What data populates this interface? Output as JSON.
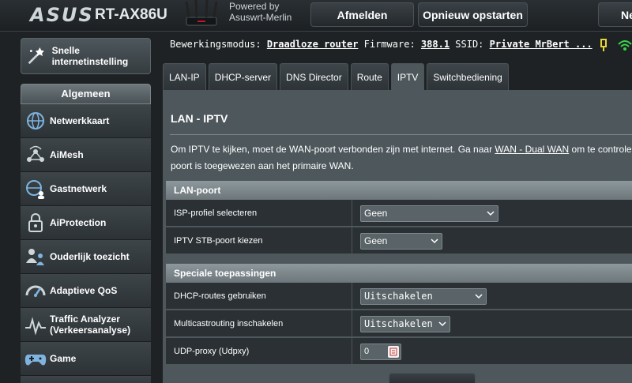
{
  "header": {
    "brand": "ASUS",
    "model": "RT-AX86U",
    "powered_by_line1": "Powered by",
    "powered_by_line2": "Asuswrt-Merlin",
    "logout_label": "Afmelden",
    "reboot_label": "Opnieuw opstarten",
    "partial_button_label": "Ne"
  },
  "status": {
    "mode_label": "Bewerkingsmodus:",
    "mode_value": "Draadloze router",
    "firmware_label": "Firmware:",
    "firmware_value": "388.1",
    "ssid_label": "SSID:",
    "ssid_value": "Private MrBert ..."
  },
  "sidebar": {
    "quick_setup": "Snelle internetinstelling",
    "section_title": "Algemeen",
    "items": [
      {
        "label": "Netwerkkaart",
        "icon": "network-map-icon"
      },
      {
        "label": "AiMesh",
        "icon": "aimesh-icon"
      },
      {
        "label": "Gastnetwerk",
        "icon": "guest-network-icon"
      },
      {
        "label": "AiProtection",
        "icon": "aiprotection-lock-icon"
      },
      {
        "label": "Ouderlijk toezicht",
        "icon": "parental-control-icon"
      },
      {
        "label": "Adaptieve QoS",
        "icon": "qos-gauge-icon"
      },
      {
        "label": "Traffic Analyzer (Verkeersanalyse)",
        "icon": "traffic-analyzer-icon"
      },
      {
        "label": "Game",
        "icon": "gamepad-icon"
      }
    ]
  },
  "tabs": [
    {
      "label": "LAN-IP",
      "active": false
    },
    {
      "label": "DHCP-server",
      "active": false
    },
    {
      "label": "DNS Director",
      "active": false
    },
    {
      "label": "Route",
      "active": false
    },
    {
      "label": "IPTV",
      "active": true
    },
    {
      "label": "Switchbediening",
      "active": false
    }
  ],
  "main": {
    "title": "LAN - IPTV",
    "desc_part1": "Om IPTV te kijken, moet de WAN-poort verbonden zijn met internet. Ga naar ",
    "desc_link": "WAN - Dual WAN",
    "desc_part2": " om te controleren",
    "desc_line2": "poort is toegewezen aan het primaire WAN.",
    "lan_section": "LAN-poort",
    "isp_label": "ISP-profiel selecteren",
    "isp_value": "Geen",
    "stb_label": "IPTV STB-poort kiezen",
    "stb_value": "Geen",
    "special_section": "Speciale toepassingen",
    "dhcp_routes_label": "DHCP-routes gebruiken",
    "dhcp_routes_value": "Uitschakelen",
    "multicast_label": "Multicastrouting inschakelen",
    "multicast_value": "Uitschakelen",
    "udp_label": "UDP-proxy (Udpxy)",
    "udp_value": "0"
  },
  "colors": {
    "panel": "#4d575c",
    "row": "#2a3034",
    "accent_wifi": "#39d24a",
    "accent_usb": "#e8d53a"
  }
}
